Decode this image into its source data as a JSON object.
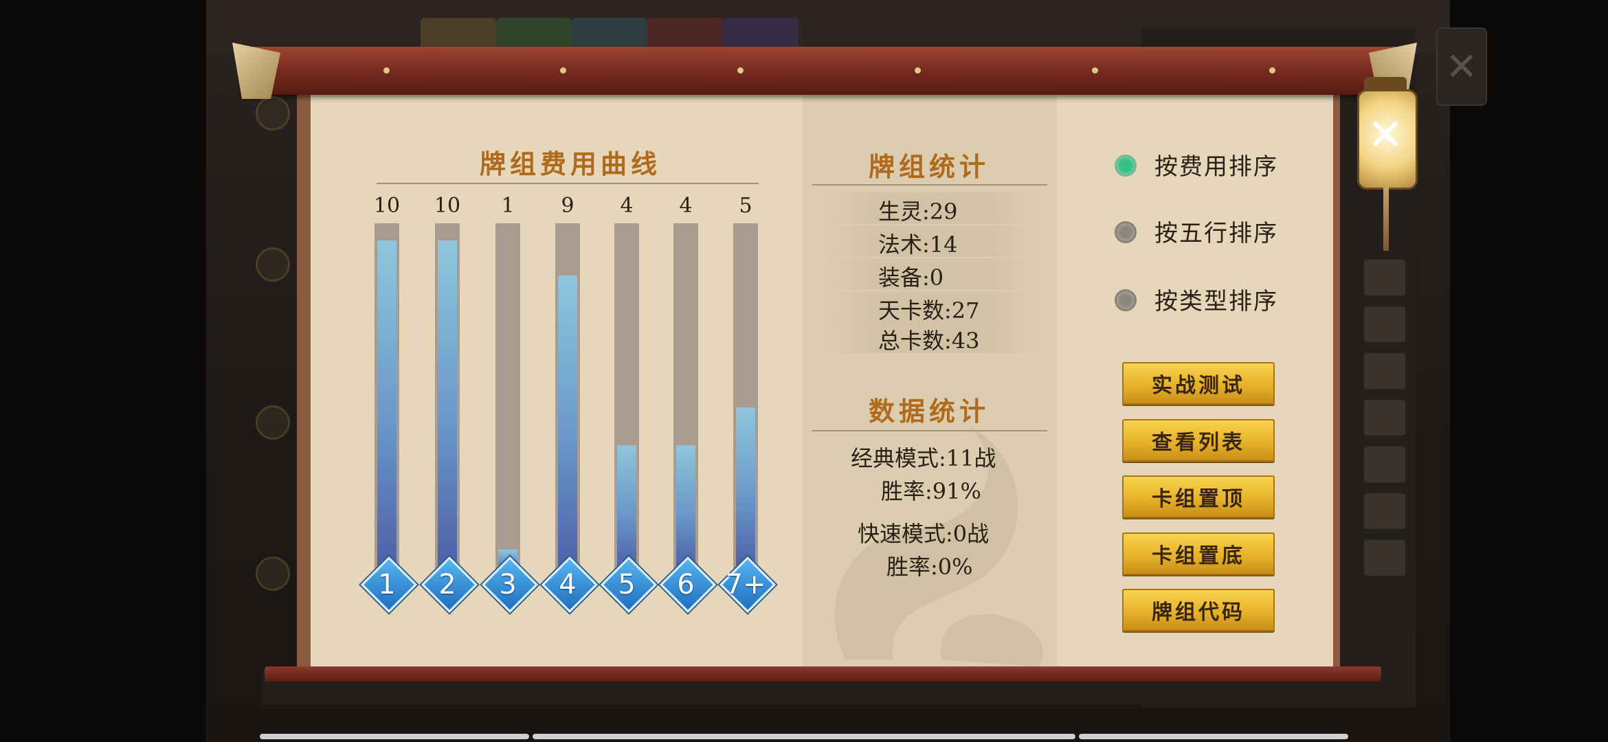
{
  "cost_curve": {
    "title": "牌组费用曲线",
    "bars": [
      {
        "cost": "1",
        "count": 10
      },
      {
        "cost": "2",
        "count": 10
      },
      {
        "cost": "3",
        "count": 1
      },
      {
        "cost": "4",
        "count": 9
      },
      {
        "cost": "5",
        "count": 4
      },
      {
        "cost": "6",
        "count": 4
      },
      {
        "cost": "7+",
        "count": 5
      }
    ],
    "bar_fill_fraction": [
      0.95,
      0.95,
      0.06,
      0.85,
      0.36,
      0.36,
      0.47
    ]
  },
  "deck_stats": {
    "title": "牌组统计",
    "rows": [
      "生灵:29",
      "法术:14",
      "装备:0",
      "天卡数:27",
      "总卡数:43"
    ]
  },
  "data_stats": {
    "title": "数据统计",
    "classic_mode": "经典模式:11战",
    "classic_winrate": "胜率:91%",
    "quick_mode": "快速模式:0战",
    "quick_winrate": "胜率:0%"
  },
  "sort_options": [
    {
      "label": "按费用排序",
      "selected": true
    },
    {
      "label": "按五行排序",
      "selected": false
    },
    {
      "label": "按类型排序",
      "selected": false
    }
  ],
  "buttons": [
    "实战测试",
    "查看列表",
    "卡组置顶",
    "卡组置底",
    "牌组代码"
  ],
  "close_label": "✕",
  "colors": {
    "title_gold": "#b06a1c",
    "bar_blue": "#6a98c9",
    "button_gold": "#e7b22a",
    "radio_selected": "#35c184"
  }
}
